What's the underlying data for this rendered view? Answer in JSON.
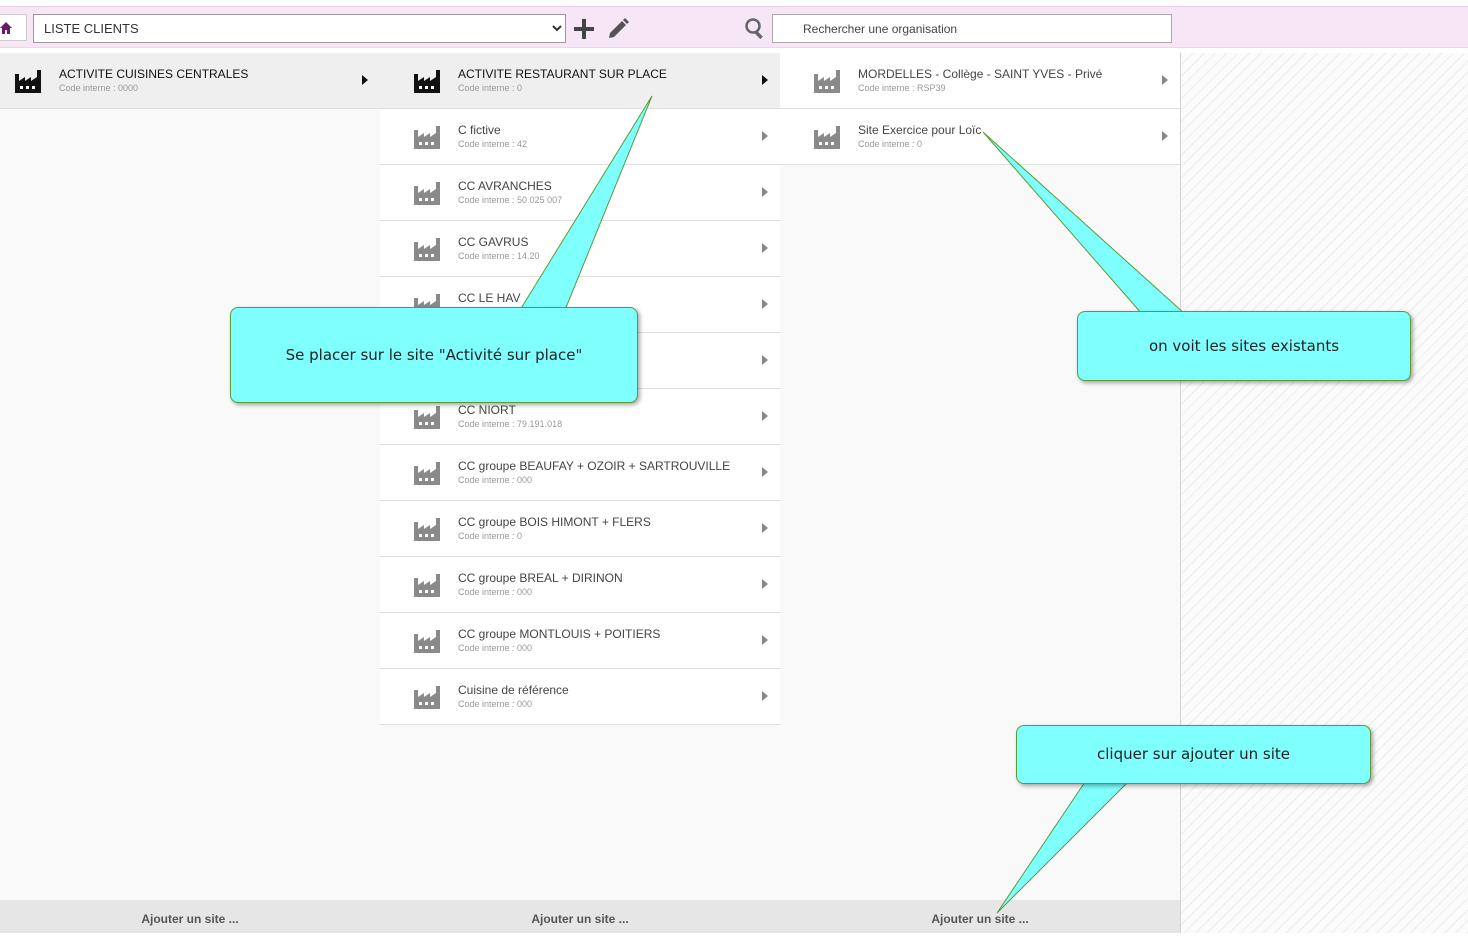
{
  "toolbar": {
    "selected_list": "LISTE CLIENTS",
    "search_placeholder": "Rechercher une organisation"
  },
  "columns": [
    {
      "items": [
        {
          "name": "ACTIVITE CUISINES CENTRALES",
          "code": "Code interne : 0000",
          "selected": true
        }
      ],
      "footer": "Ajouter un site ..."
    },
    {
      "items": [
        {
          "name": "ACTIVITE RESTAURANT SUR PLACE",
          "code": "Code interne : 0",
          "selected": true
        },
        {
          "name": "C fictive",
          "code": "Code interne : 42"
        },
        {
          "name": "CC AVRANCHES",
          "code": "Code interne : 50 025 007"
        },
        {
          "name": "CC GAVRUS",
          "code": "Code interne : 14.20"
        },
        {
          "name": "CC LE HAV",
          "code": ""
        },
        {
          "name": "",
          "code": ""
        },
        {
          "name": "CC NIORT",
          "code": "Code interne : 79.191.018"
        },
        {
          "name": "CC groupe BEAUFAY + OZOIR + SARTROUVILLE",
          "code": "Code interne : 000"
        },
        {
          "name": "CC groupe BOIS HIMONT + FLERS",
          "code": "Code interne : 0"
        },
        {
          "name": "CC groupe BREAL + DIRINON",
          "code": "Code interne : 000"
        },
        {
          "name": "CC groupe MONTLOUIS + POITIERS",
          "code": "Code interne : 000"
        },
        {
          "name": "Cuisine de référence",
          "code": "Code interne : 000"
        }
      ],
      "footer": "Ajouter un site ..."
    },
    {
      "items": [
        {
          "name": "MORDELLES - Collège - SAINT YVES - Privé",
          "code": "Code interne : RSP39"
        },
        {
          "name": "Site Exercice pour Loïc",
          "code": "Code interne : 0"
        }
      ],
      "footer": "Ajouter un site ..."
    }
  ],
  "callouts": [
    {
      "text": "Se placer sur le site \"Activité sur place\""
    },
    {
      "text": "on voit les sites existants"
    },
    {
      "text": "cliquer sur ajouter un site"
    }
  ],
  "colors": {
    "toolbar_bg": "#f6e6f6",
    "home_icon": "#6a1b6a",
    "callout_fill": "#80ffff",
    "callout_border": "#5a9a3a"
  }
}
